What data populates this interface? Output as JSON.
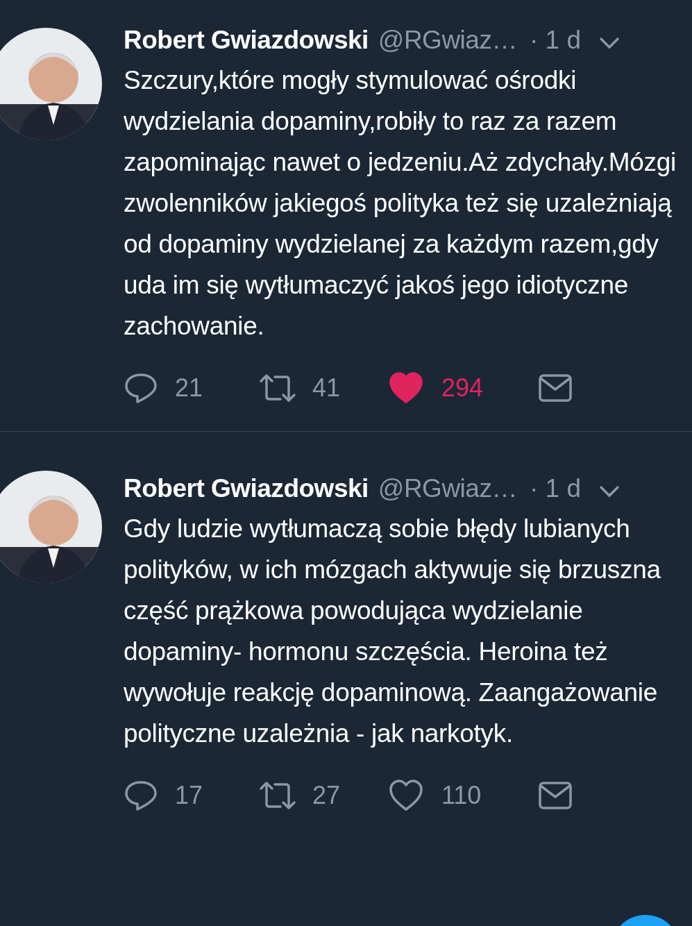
{
  "tweets": [
    {
      "name": "Robert Gwiazdowski",
      "handle": "@RGwiaz…",
      "time": "· 1 d",
      "text": "Szczury,które mogły stymulować ośrodki wydzielania dopaminy,robiły to raz za razem zapominając nawet o jedzeniu.Aż zdychały.Mózgi zwolenników jakiegoś polityka też się uzależniają od dopaminy wydzielanej za każdym razem,gdy uda im się wytłumaczyć jakoś jego idiotyczne zachowanie.",
      "replies": "21",
      "retweets": "41",
      "likes": "294",
      "liked": true
    },
    {
      "name": "Robert Gwiazdowski",
      "handle": "@RGwiaz…",
      "time": "· 1 d",
      "text": "Gdy ludzie wytłumaczą sobie błędy lubianych polityków, w ich mózgach aktywuje się brzuszna część prążkowa powodująca wydzielanie dopaminy- hormonu szczęścia. Heroina też wywołuje reakcję dopaminową. Zaangażowanie polityczne uzależnia - jak narkotyk.",
      "replies": "17",
      "retweets": "27",
      "likes": "110",
      "liked": false
    }
  ]
}
